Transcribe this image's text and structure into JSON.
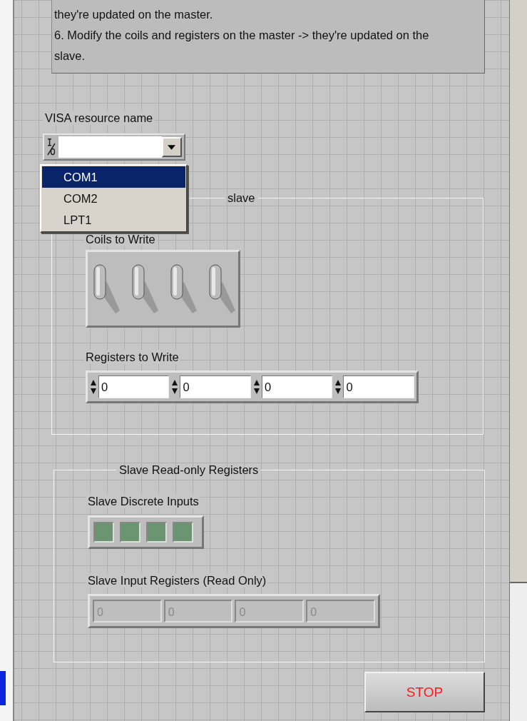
{
  "instructions": [
    "they're updated on the master.",
    "6. Modify the coils and registers on the master -> they're updated on the slave."
  ],
  "visa": {
    "label": "VISA resource name",
    "expanded": true,
    "options": [
      {
        "label": "COM1",
        "selected": true
      },
      {
        "label": "COM2",
        "selected": false
      },
      {
        "label": "LPT1",
        "selected": false
      }
    ]
  },
  "write_group": {
    "title": "slave",
    "coils": {
      "label": "Coils to Write",
      "switches": [
        {
          "on": false
        },
        {
          "on": false
        },
        {
          "on": false
        },
        {
          "on": false
        }
      ]
    },
    "registers": {
      "label": "Registers to Write",
      "values": [
        "0",
        "0",
        "0",
        "0"
      ]
    }
  },
  "read_group": {
    "title": "Slave Read-only Registers",
    "discrete_inputs": {
      "label": "Slave Discrete Inputs",
      "leds": [
        {
          "on": false
        },
        {
          "on": false
        },
        {
          "on": false
        },
        {
          "on": false
        }
      ]
    },
    "input_registers": {
      "label": "Slave Input Registers (Read Only)",
      "values": [
        "0",
        "0",
        "0",
        "0"
      ]
    }
  },
  "stop_button": {
    "label": "STOP"
  }
}
